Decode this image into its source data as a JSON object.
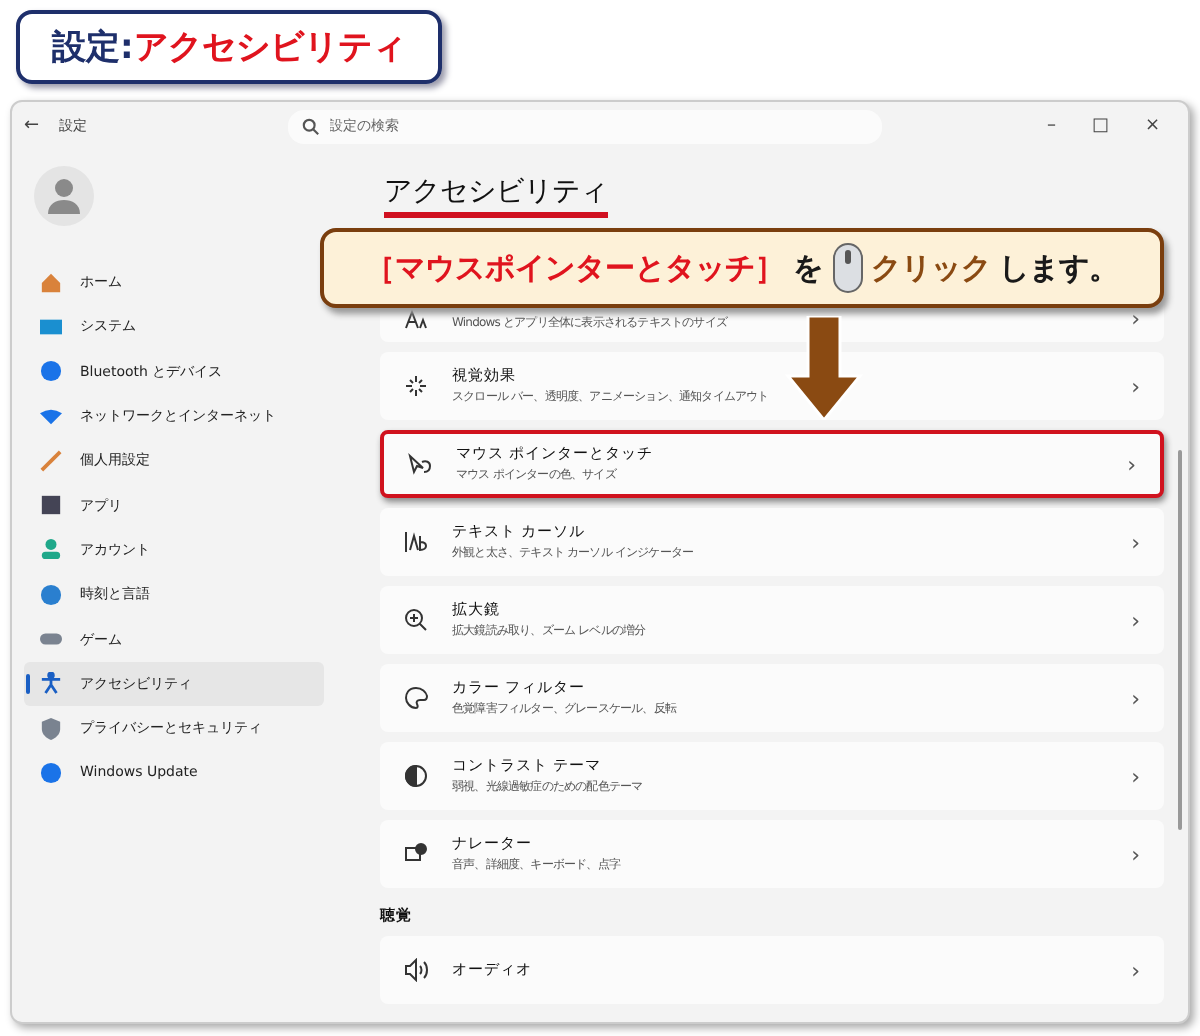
{
  "banner": {
    "label": "設定",
    "separator": ":",
    "title": "アクセシビリティ"
  },
  "window": {
    "back": "←",
    "title": "設定",
    "search": {
      "placeholder": "設定の検索"
    },
    "controls": [
      "–",
      "□",
      "×"
    ]
  },
  "sidebar": {
    "items": [
      {
        "label": "ホーム",
        "selected": false
      },
      {
        "label": "システム",
        "selected": false
      },
      {
        "label": "Bluetooth とデバイス",
        "selected": false
      },
      {
        "label": "ネットワークとインターネット",
        "selected": false
      },
      {
        "label": "個人用設定",
        "selected": false
      },
      {
        "label": "アプリ",
        "selected": false
      },
      {
        "label": "アカウント",
        "selected": false
      },
      {
        "label": "時刻と言語",
        "selected": false
      },
      {
        "label": "ゲーム",
        "selected": false
      },
      {
        "label": "アクセシビリティ",
        "selected": true
      },
      {
        "label": "プライバシーとセキュリティ",
        "selected": false
      },
      {
        "label": "Windows Update",
        "selected": false
      }
    ]
  },
  "page": {
    "title": "アクセシビリティ"
  },
  "callout": {
    "parts": [
      {
        "kind": "emphasis",
        "text": "［マウスポインターとタッチ］"
      },
      {
        "kind": "plain",
        "text": "を"
      },
      {
        "kind": "mouse"
      },
      {
        "kind": "action",
        "text": "クリック"
      },
      {
        "kind": "plain",
        "text": "します。"
      }
    ]
  },
  "cards": [
    {
      "kind": "card",
      "subtitle": "Windows とアプリ全体に表示されるテキストのサイズ",
      "highlighted": false
    },
    {
      "kind": "card",
      "title": "視覚効果",
      "subtitle": "スクロール バー、透明度、アニメーション、通知タイムアウト",
      "highlighted": false
    },
    {
      "kind": "card",
      "title": "マウス ポインターとタッチ",
      "subtitle": "マウス ポインターの色、サイズ",
      "highlighted": true
    },
    {
      "kind": "card",
      "title": "テキスト カーソル",
      "subtitle": "外観と太さ、テキスト カーソル インジケーター",
      "highlighted": false
    },
    {
      "kind": "card",
      "title": "拡大鏡",
      "subtitle": "拡大鏡読み取り、ズーム レベルの増分",
      "highlighted": false
    },
    {
      "kind": "card",
      "title": "カラー フィルター",
      "subtitle": "色覚障害フィルター、グレースケール、反転",
      "highlighted": false
    },
    {
      "kind": "card",
      "title": "コントラスト テーマ",
      "subtitle": "弱視、光線過敏症のための配色テーマ",
      "highlighted": false
    },
    {
      "kind": "card",
      "title": "ナレーター",
      "subtitle": "音声、詳細度、キーボード、点字",
      "highlighted": false
    },
    {
      "kind": "section",
      "title": "聴覚"
    },
    {
      "kind": "card",
      "title": "オーディオ",
      "highlighted": false
    }
  ],
  "chevron": "›"
}
